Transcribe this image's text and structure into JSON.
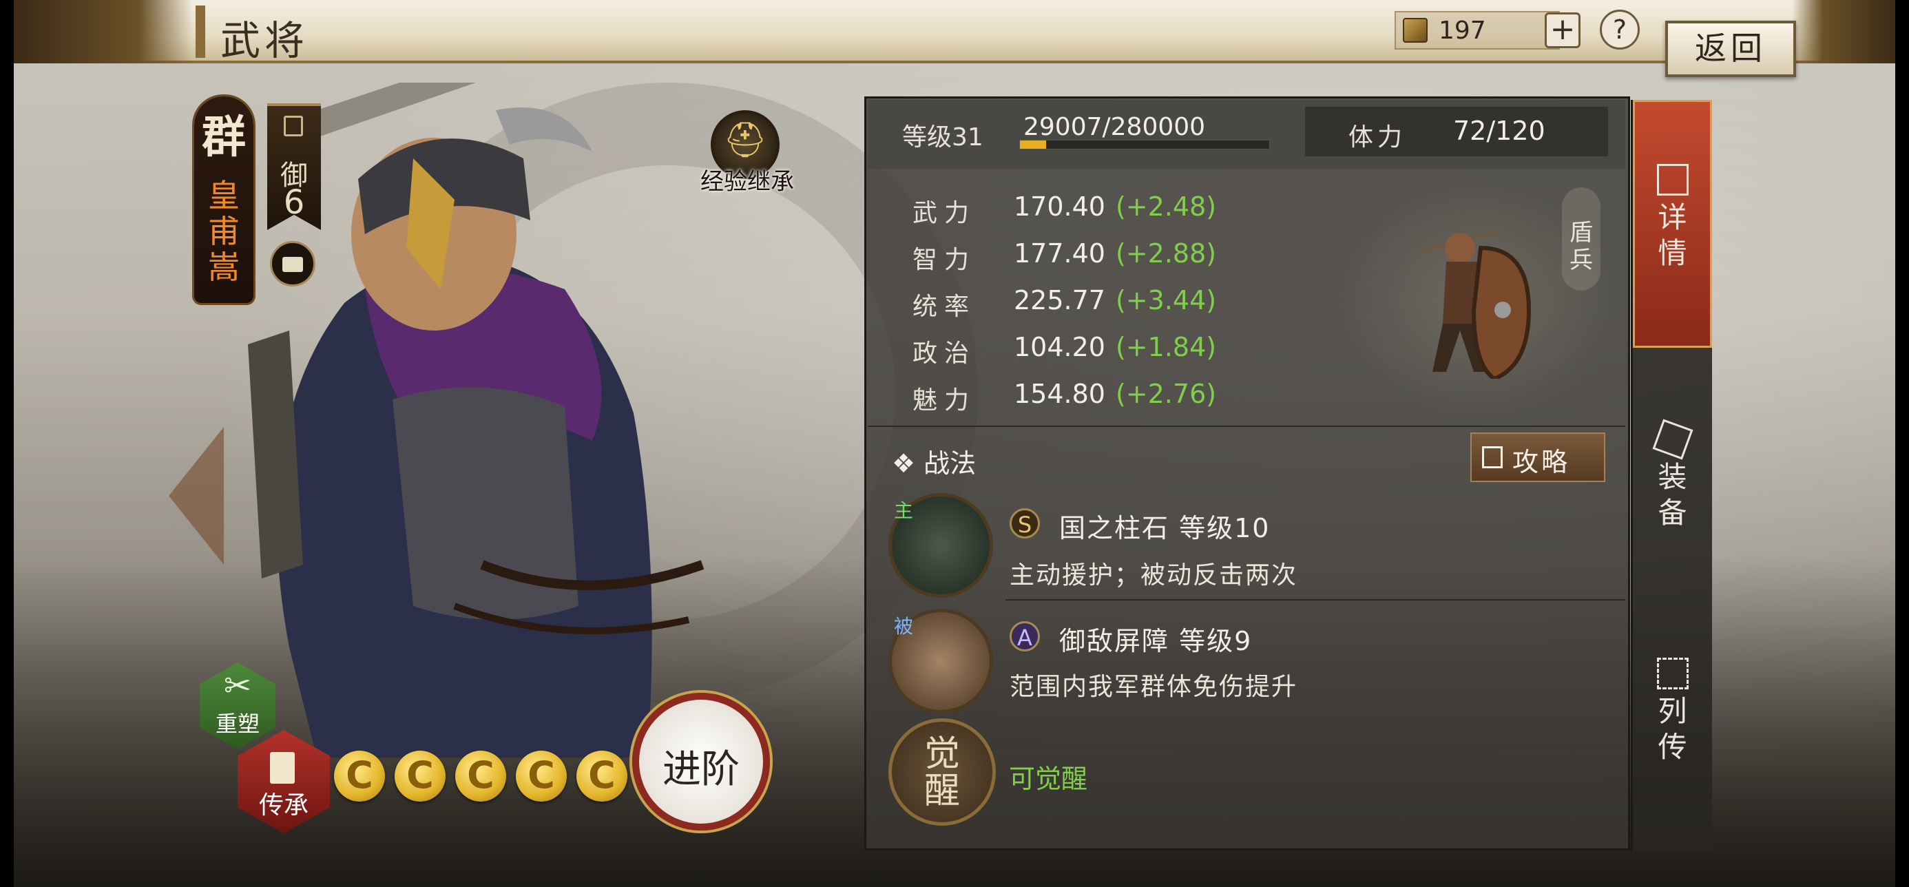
{
  "header": {
    "title": "武将",
    "currency_value": "197",
    "plus_symbol": "+",
    "help_symbol": "?",
    "back_label": "返回"
  },
  "hero": {
    "faction": "群",
    "name": "皇甫嵩",
    "role_char": "御",
    "role_num": "6",
    "exp_inherit_label": "经验继承",
    "remold_label": "重塑",
    "pass_on_label": "传承",
    "advance_label": "进阶",
    "advancement_stars": 5
  },
  "panel": {
    "level_label": "等级31",
    "exp_text": "29007/280000",
    "exp_progress": 0.1036,
    "stamina_label": "体力",
    "stamina_value": "72/120",
    "stats": [
      {
        "label": "武力",
        "value": "170.40",
        "bonus": "(+2.48)"
      },
      {
        "label": "智力",
        "value": "177.40",
        "bonus": "(+2.88)"
      },
      {
        "label": "统率",
        "value": "225.77",
        "bonus": "(+3.44)"
      },
      {
        "label": "政治",
        "value": "104.20",
        "bonus": "(+1.84)"
      },
      {
        "label": "魅力",
        "value": "154.80",
        "bonus": "(+2.76)"
      }
    ],
    "troop_type": "盾兵",
    "tactics_header": "❖ 战法",
    "guide_label": "攻略",
    "skills": [
      {
        "tag": "主",
        "grade": "S",
        "name": "国之柱石  等级10",
        "desc": "主动援护；被动反击两次"
      },
      {
        "tag": "被",
        "grade": "A",
        "name": "御敌屏障  等级9",
        "desc": "范围内我军群体免伤提升"
      }
    ],
    "awaken_char": "觉醒",
    "awaken_label": "可觉醒"
  },
  "side_tabs": [
    {
      "label": "详情",
      "active": true
    },
    {
      "label": "装备",
      "active": false
    },
    {
      "label": "列传",
      "active": false
    }
  ],
  "colors": {
    "bonus_green": "#7fcf4a",
    "name_orange": "#f28a24",
    "active_tab_red": "#c44a2f",
    "exp_fill": "#e8b020"
  }
}
